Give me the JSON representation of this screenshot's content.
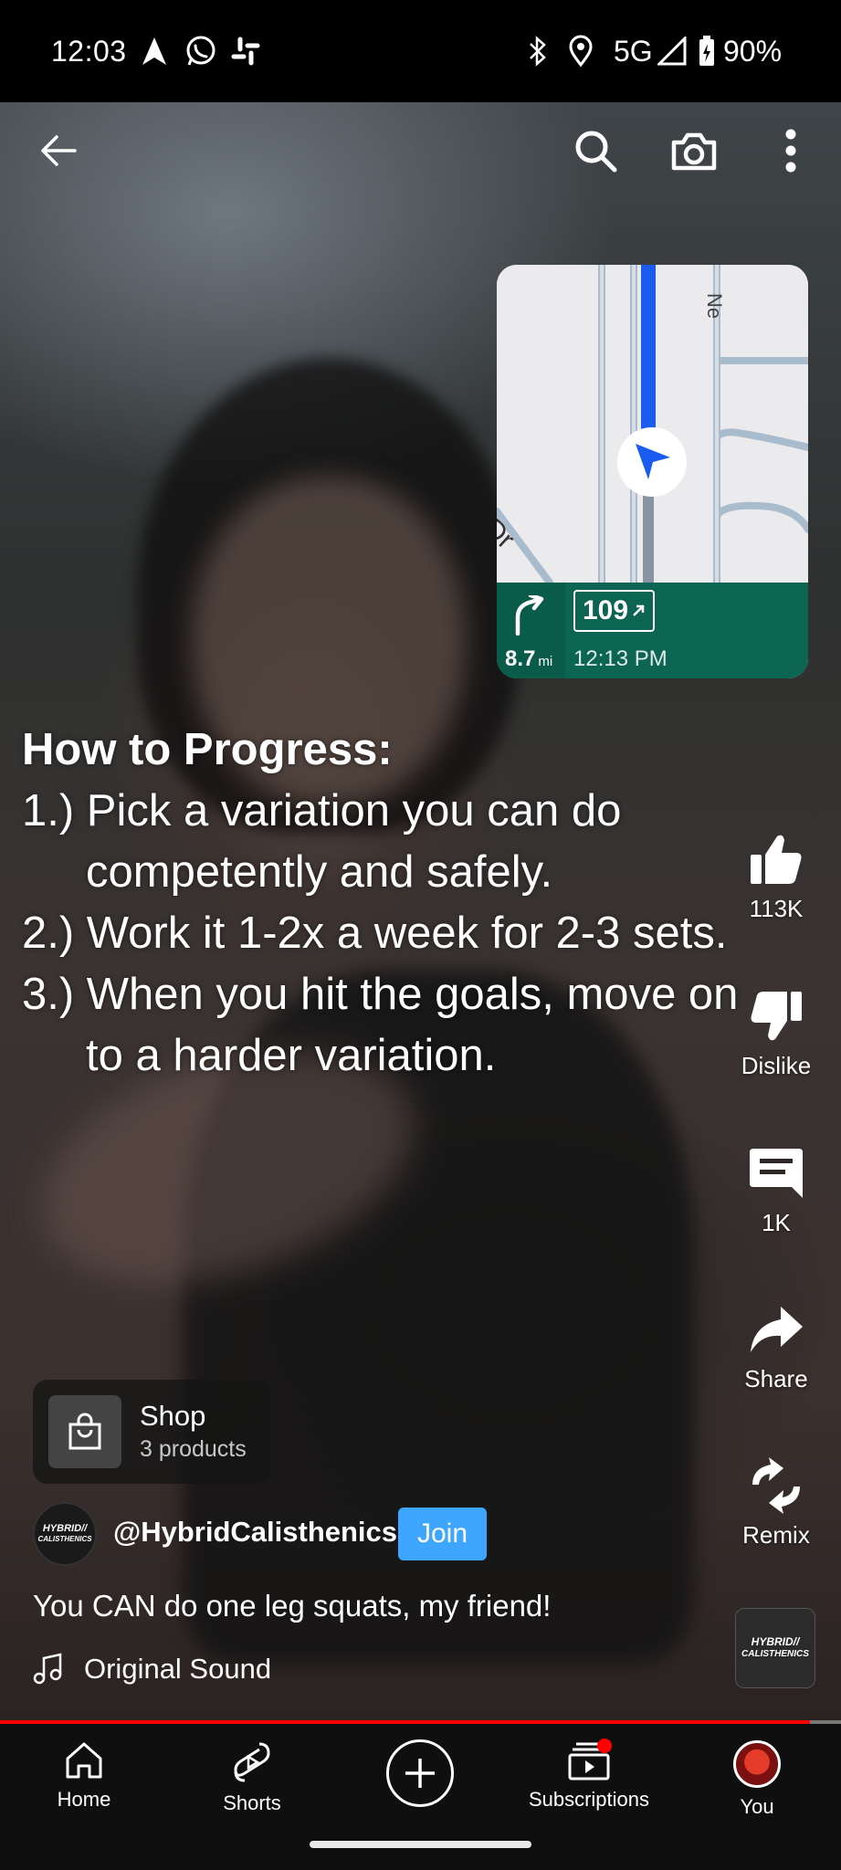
{
  "status_bar": {
    "time": "12:03",
    "network": "5G",
    "battery": "90%",
    "icons": [
      "navigation-arrow-icon",
      "whatsapp-icon",
      "slack-icon",
      "bluetooth-icon",
      "location-icon",
      "signal-icon",
      "battery-charging-icon"
    ]
  },
  "top_bar": {
    "icons": [
      "back-arrow-icon",
      "search-icon",
      "camera-icon",
      "more-vert-icon"
    ]
  },
  "navigation_overlay": {
    "street_label_1": "Dr",
    "street_label_2": "Ne",
    "distance": "8.7",
    "distance_unit": "mi",
    "route_number": "109",
    "eta": "12:13 PM",
    "colors": {
      "route": "#1a5cf0",
      "nav_bar": "#0b6552"
    }
  },
  "caption": {
    "heading": "How to Progress:",
    "line1": "1.) Pick a variation you can do",
    "line1_cont": "competently and safely.",
    "line2": "2.) Work it 1-2x a week for 2-3 sets.",
    "line3": "3.) When you hit the goals, move on",
    "line3_cont": "to a harder variation."
  },
  "actions": {
    "like_count": "113K",
    "dislike_label": "Dislike",
    "comment_count": "1K",
    "share_label": "Share",
    "remix_label": "Remix"
  },
  "shop": {
    "title": "Shop",
    "subtitle": "3 products"
  },
  "channel": {
    "handle": "@HybridCalisthenics",
    "join_label": "Join",
    "avatar_text_1": "HYBRID//",
    "avatar_text_2": "CALISTHENICS"
  },
  "video": {
    "title": "You CAN do one leg squats, my friend!",
    "sound_label": "Original Sound",
    "progress": 0.963
  },
  "bottom_nav": {
    "home": "Home",
    "shorts": "Shorts",
    "subscriptions": "Subscriptions",
    "you": "You"
  },
  "colors": {
    "accent": "#ff0000",
    "join_button": "#3ea6ff",
    "nav_background": "#0f0f0f"
  }
}
